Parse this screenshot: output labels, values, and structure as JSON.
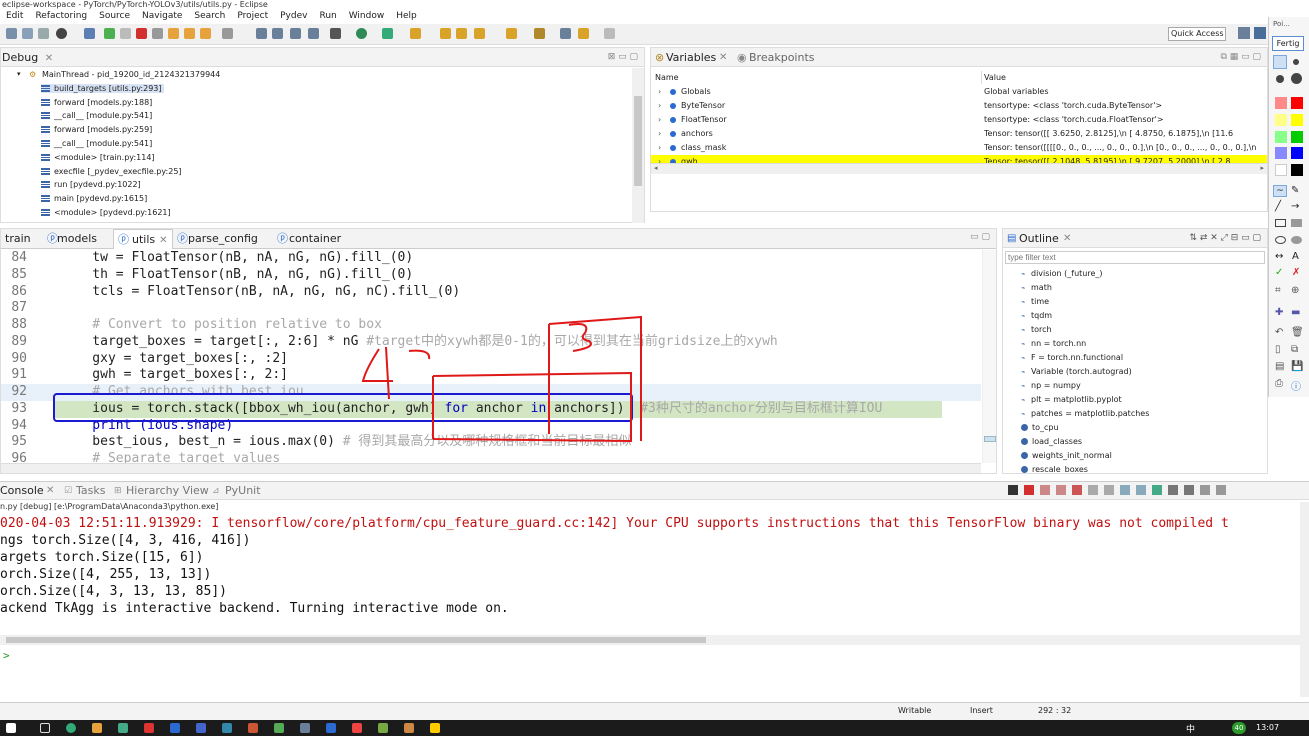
{
  "window": {
    "title": "eclipse-workspace - PyTorch/PyTorch-YOLOv3/utils/utils.py - Eclipse"
  },
  "menu": [
    "Edit",
    "Refactoring",
    "Source",
    "Navigate",
    "Search",
    "Project",
    "Pydev",
    "Run",
    "Window",
    "Help"
  ],
  "quick_access": "Quick Access",
  "debug": {
    "title": "Debug",
    "thread": "MainThread - pid_19200_id_2124321379944",
    "frames": [
      "build_targets [utils.py:293]",
      "forward [models.py:188]",
      "__call__ [module.py:541]",
      "forward [models.py:259]",
      "__call__ [module.py:541]",
      "<module> [train.py:114]",
      "execfile [_pydev_execfile.py:25]",
      "run [pydevd.py:1022]",
      "main [pydevd.py:1615]",
      "<module> [pydevd.py:1621]"
    ]
  },
  "variables": {
    "tab_variables": "Variables",
    "tab_breakpoints": "Breakpoints",
    "col_name": "Name",
    "col_value": "Value",
    "rows": [
      {
        "name": "Globals",
        "value": "Global variables"
      },
      {
        "name": "ByteTensor",
        "value": "tensortype: <class 'torch.cuda.ByteTensor'>"
      },
      {
        "name": "FloatTensor",
        "value": "tensortype: <class 'torch.cuda.FloatTensor'>"
      },
      {
        "name": "anchors",
        "value": "Tensor: tensor([[ 3.6250,  2.8125],\\n         [ 4.8750,  6.1875],\\n         [11.6"
      },
      {
        "name": "class_mask",
        "value": "Tensor: tensor([[[[0., 0., 0.,  ..., 0., 0., 0.],\\n          [0., 0., 0.,  ..., 0., 0., 0.],\\n"
      },
      {
        "name": "gwh",
        "value": "Tensor: tensor([[ 2.1048,  5.8195],\\n         [ 9.7207,  5.2000],\\n         [ 2.8"
      }
    ]
  },
  "palette": {
    "label": "Poi...",
    "button": "Fertig"
  },
  "editor": {
    "tabs": [
      "train",
      "models",
      "utils",
      "parse_config",
      "container"
    ],
    "lines": [
      {
        "n": "84",
        "code": "    tw = FloatTensor(nB, nA, nG, nG).fill_(0)"
      },
      {
        "n": "85",
        "code": "    th = FloatTensor(nB, nA, nG, nG).fill_(0)"
      },
      {
        "n": "86",
        "code": "    tcls = FloatTensor(nB, nA, nG, nG, nC).fill_(0)"
      },
      {
        "n": "87",
        "code": ""
      },
      {
        "n": "88",
        "code": "    # Convert to position relative to box"
      },
      {
        "n": "89",
        "code": "    target_boxes = target[:, 2:6] * nG",
        "comment": " #target中的xywh都是0-1的，可以得到其在当前gridsize上的xywh"
      },
      {
        "n": "90",
        "code": "    gxy = target_boxes[:, :2]"
      },
      {
        "n": "91",
        "code": "    gwh = target_boxes[:, 2:]"
      },
      {
        "n": "92",
        "code": "    # Get anchors with best iou"
      },
      {
        "n": "93",
        "pre": "    ious = torch.stack([bbox_wh_iou(anchor, gwh) ",
        "kw1": "for",
        "mid": " anchor ",
        "kw2": "in",
        "post": " anchors])",
        "comment": "  #3种尺寸的anchor分别与目标框计算IOU"
      },
      {
        "n": "94",
        "code": "    print (ious.shape)"
      },
      {
        "n": "95",
        "code": "    best_ious, best_n = ious.max(0)",
        "comment": " # 得到其最高分以及哪种规格框和当前目标最相似"
      },
      {
        "n": "96",
        "code": "    # Separate target values"
      }
    ]
  },
  "outline": {
    "title": "Outline",
    "filter_placeholder": "type filter text",
    "items": [
      "division (_future_)",
      "math",
      "time",
      "tqdm",
      "torch",
      "nn = torch.nn",
      "F = torch.nn.functional",
      "Variable (torch.autograd)",
      "np = numpy",
      "plt = matplotlib.pyplot",
      "patches = matplotlib.patches"
    ],
    "functions": [
      "to_cpu",
      "load_classes",
      "weights_init_normal",
      "rescale_boxes"
    ]
  },
  "console": {
    "tabs": [
      "Console",
      "Tasks",
      "Hierarchy View",
      "PyUnit"
    ],
    "process": "n.py [debug] [e:\\ProgramData\\Anaconda3\\python.exe]",
    "lines": [
      {
        "text": "020-04-03 12:51:11.913929: I tensorflow/core/platform/cpu_feature_guard.cc:142] Your CPU supports instructions that this TensorFlow binary was not compiled t",
        "color": "#c01010"
      },
      {
        "text": "ngs torch.Size([4, 3, 416, 416])",
        "color": "#111111"
      },
      {
        "text": "argets torch.Size([15, 6])",
        "color": "#111111"
      },
      {
        "text": "orch.Size([4, 255, 13, 13])",
        "color": "#111111"
      },
      {
        "text": "orch.Size([4, 3, 13, 13, 85])",
        "color": "#111111"
      },
      {
        "text": "ackend TkAgg is interactive backend. Turning interactive mode on.",
        "color": "#111111"
      }
    ],
    "prompt": ">"
  },
  "status": {
    "writable": "Writable",
    "insert": "Insert",
    "position": "292 : 32"
  },
  "taskbar": {
    "time": "13:07",
    "tray_badge": "40",
    "ime": "中"
  },
  "annotations": {
    "label_1": "1",
    "label_3": "3",
    "color_blue": "#1a1ad0",
    "color_red": "#e01818"
  }
}
